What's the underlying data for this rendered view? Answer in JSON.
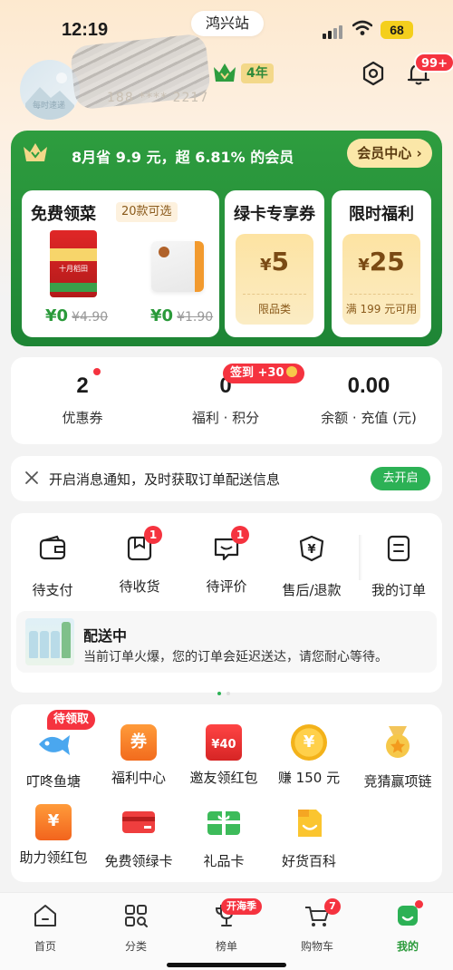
{
  "status_bar": {
    "time": "12:19",
    "station": "鸿兴站",
    "battery": "68"
  },
  "profile": {
    "avatar_caption": "每时速递",
    "phone_masked": "188 **** 2217",
    "member_years": "4年",
    "notification_count": "99+"
  },
  "membership": {
    "savings_text": "8月省 9.9 元，超 6.81% 的会员",
    "center_button": "会员中心 ›",
    "free_veg": {
      "title": "免费领菜",
      "tag": "20款可选",
      "items": [
        {
          "product_label": "十月稻田",
          "price": "¥0",
          "old_price": "¥4.90"
        },
        {
          "price": "¥0",
          "old_price": "¥1.90"
        }
      ]
    },
    "green_card_coupon": {
      "title": "绿卡专享券",
      "currency": "¥",
      "amount": "5",
      "condition": "限品类"
    },
    "limited_welfare": {
      "title": "限时福利",
      "currency": "¥",
      "amount": "25",
      "condition": "满 199 元可用"
    }
  },
  "stats": {
    "coupons": {
      "value": "2",
      "label": "优惠券"
    },
    "points": {
      "value": "0",
      "label": "福利 · 积分",
      "badge": "签到 +30"
    },
    "balance": {
      "value": "0.00",
      "label": "余额 · 充值 (元)"
    }
  },
  "notification_bar": {
    "text": "开启消息通知，及时获取订单配送信息",
    "button": "去开启"
  },
  "orders": {
    "items": [
      {
        "label": "待支付",
        "icon": "wallet-icon",
        "badge": ""
      },
      {
        "label": "待收货",
        "icon": "package-icon",
        "badge": "1"
      },
      {
        "label": "待评价",
        "icon": "comment-icon",
        "badge": "1"
      },
      {
        "label": "售后/退款",
        "icon": "refund-icon",
        "badge": ""
      },
      {
        "label": "我的订单",
        "icon": "order-list-icon",
        "badge": ""
      }
    ],
    "delivery": {
      "title": "配送中",
      "desc": "当前订单火爆，您的订单会延迟送达，请您耐心等待。"
    }
  },
  "services": {
    "row1": [
      {
        "label": "叮咚鱼塘",
        "icon": "fish-icon",
        "badge": "待领取"
      },
      {
        "label": "福利中心",
        "icon": "welfare-coupon-icon",
        "glyph": "券"
      },
      {
        "label": "邀友领红包",
        "icon": "red-packet-icon",
        "glyph": "¥40"
      },
      {
        "label": "赚 150 元",
        "icon": "coin-icon",
        "glyph": "¥"
      },
      {
        "label": "竞猜赢项链",
        "icon": "medal-icon"
      }
    ],
    "row2": [
      {
        "label": "助力领红包",
        "icon": "help-red-packet-icon",
        "glyph": "¥"
      },
      {
        "label": "免费领绿卡",
        "icon": "card-icon"
      },
      {
        "label": "礼品卡",
        "icon": "gift-card-icon"
      },
      {
        "label": "好货百科",
        "icon": "encyclopedia-icon"
      }
    ]
  },
  "tabbar": {
    "items": [
      {
        "label": "首页",
        "icon": "home-icon"
      },
      {
        "label": "分类",
        "icon": "category-icon"
      },
      {
        "label": "榜单",
        "icon": "trophy-icon",
        "badge": "开海季"
      },
      {
        "label": "购物车",
        "icon": "cart-icon",
        "badge": "7"
      },
      {
        "label": "我的",
        "icon": "profile-icon",
        "active": true
      }
    ]
  },
  "colors": {
    "brand_green": "#1e8535",
    "accent_red": "#f5333f",
    "gold": "#fbe7a8"
  }
}
